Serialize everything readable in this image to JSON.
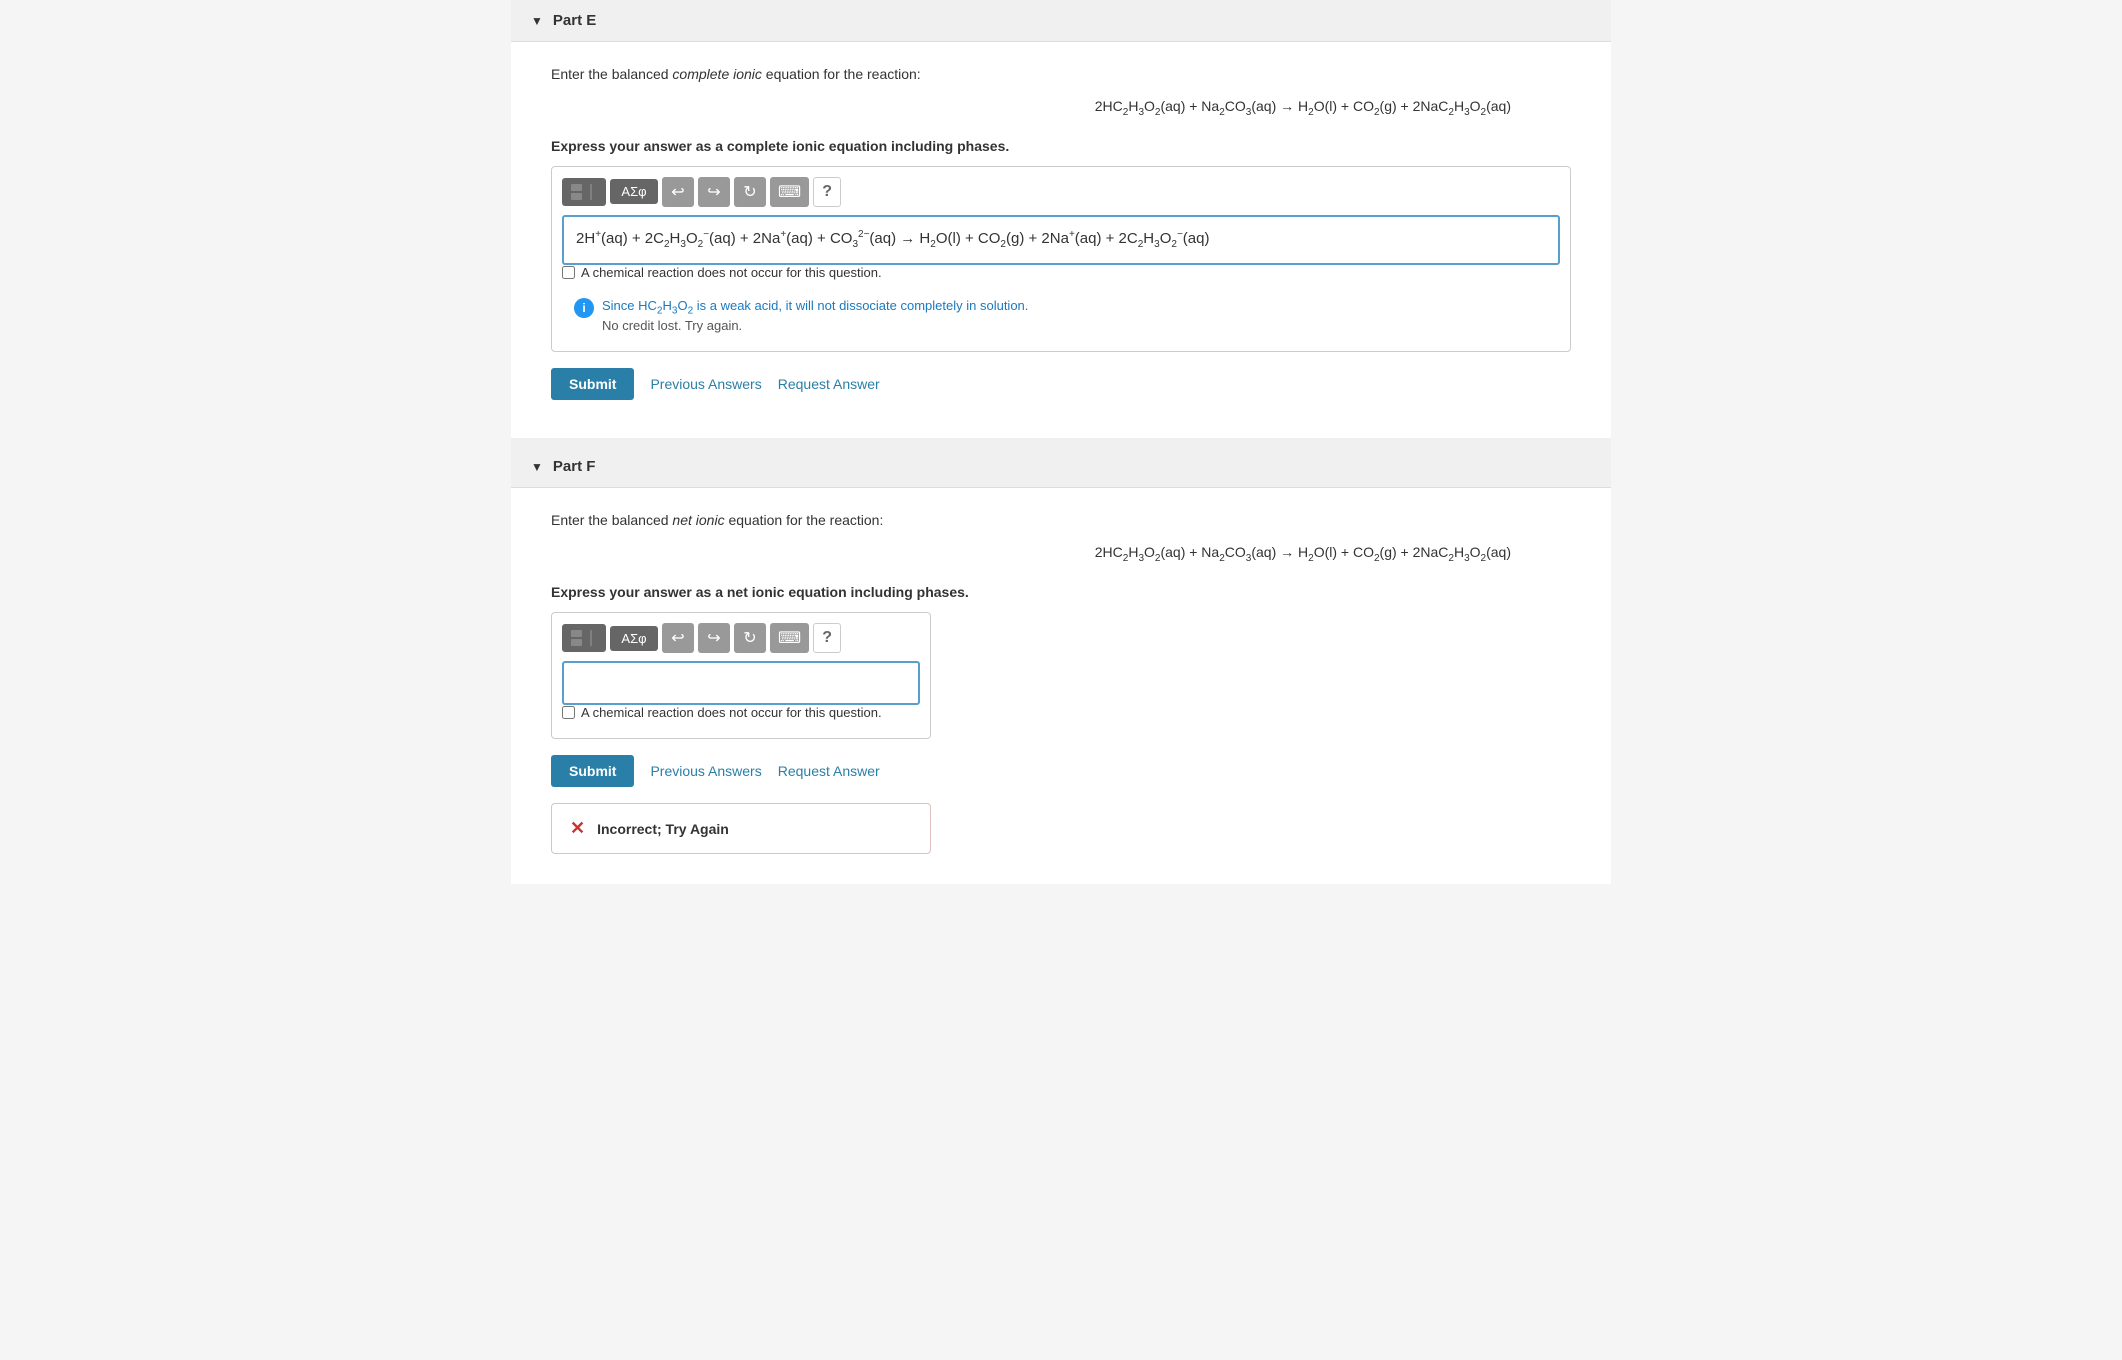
{
  "partE": {
    "title": "Part E",
    "instruction_prefix": "Enter the balanced ",
    "instruction_italic": "complete ionic",
    "instruction_suffix": " equation for the reaction:",
    "equation_display": "2HC₂H₃O₂(aq) + Na₂CO₃(aq) → H₂O(l) + CO₂(g) + 2NaC₂H₃O₂(aq)",
    "express_label": "Express your answer as a complete ionic equation including phases.",
    "toolbar": {
      "math_btn": "ΑΣφ",
      "help_btn": "?"
    },
    "input_equation": "2H⁺(aq) + 2C₂H₃O₂⁻(aq) + 2Na⁺(aq) + CO₃²⁻(aq) → H₂O(l) + CO₂(g) + 2Na⁺(aq) + 2C₂H₃O₂⁻(aq)",
    "checkbox_label": "A chemical reaction does not occur for this question.",
    "feedback_main": "Since HC₂H₃O₂ is a weak acid, it will not dissociate completely in solution.",
    "feedback_sub": "No credit lost. Try again.",
    "submit_label": "Submit",
    "previous_answers_label": "Previous Answers",
    "request_answer_label": "Request Answer"
  },
  "partF": {
    "title": "Part F",
    "instruction_prefix": "Enter the balanced ",
    "instruction_italic": "net ionic",
    "instruction_suffix": " equation for the reaction:",
    "equation_display": "2HC₂H₃O₂(aq) + Na₂CO₃(aq) → H₂O(l) + CO₂(g) + 2NaC₂H₃O₂(aq)",
    "express_label": "Express your answer as a net ionic equation including phases.",
    "toolbar": {
      "math_btn": "ΑΣφ",
      "help_btn": "?"
    },
    "input_equation": "",
    "checkbox_label": "A chemical reaction does not occur for this question.",
    "submit_label": "Submit",
    "previous_answers_label": "Previous Answers",
    "request_answer_label": "Request Answer",
    "incorrect_label": "Incorrect; Try Again"
  }
}
